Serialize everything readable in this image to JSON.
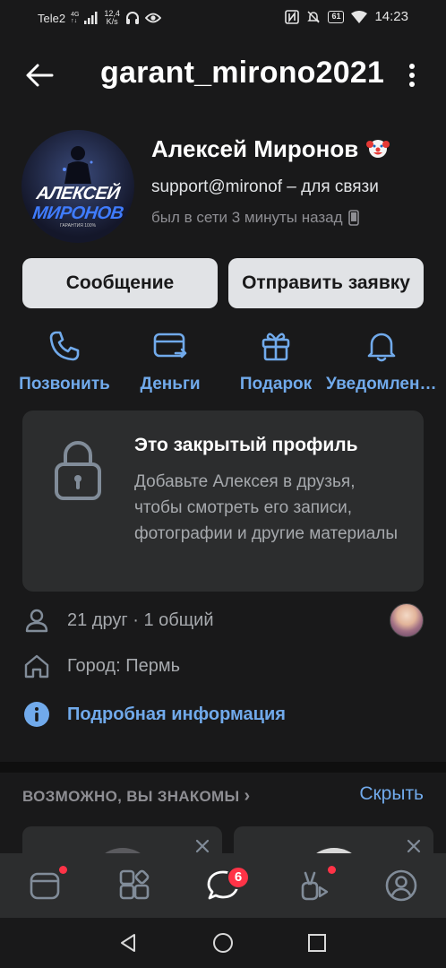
{
  "status_bar": {
    "carrier": "Tele2",
    "network_top": "4G",
    "network_bottom": "↑↓",
    "speed_value": "12,4",
    "speed_unit": "K/s",
    "battery": "61",
    "time": "14:23"
  },
  "header": {
    "title": "garant_mirono2021"
  },
  "profile": {
    "name": "Алексей Миронов",
    "name_emoji": "clown-face",
    "status": "support@mironof – для связи",
    "last_seen": "был в сети 3 минуты назад",
    "avatar_text_line1": "АЛЕКСЕЙ",
    "avatar_text_line2": "МИРОНОВ",
    "avatar_small_text": "ГАРАНТИЯ 100%"
  },
  "buttons": {
    "message": "Сообщение",
    "friend_request": "Отправить заявку"
  },
  "quick_actions": [
    {
      "label": "Позвонить",
      "icon": "phone-icon"
    },
    {
      "label": "Деньги",
      "icon": "money-transfer-icon"
    },
    {
      "label": "Подарок",
      "icon": "gift-icon"
    },
    {
      "label": "Уведомления",
      "icon": "bell-icon"
    }
  ],
  "closed_profile": {
    "title": "Это закрытый профиль",
    "text": "Добавьте Алексея в друзья, чтобы смотреть его записи, фотографии и другие материалы"
  },
  "info": {
    "friends": "21 друг · 1 общий",
    "city": "Город: Пермь",
    "details_link": "Подробная информация"
  },
  "suggestions": {
    "title": "ВОЗМОЖНО, ВЫ ЗНАКОМЫ",
    "chevron": "›",
    "hide": "Скрыть"
  },
  "tabbar": {
    "messages_badge": "6",
    "icons": [
      "news-icon",
      "services-icon",
      "messages-icon",
      "clips-icon",
      "profile-icon"
    ]
  },
  "colors": {
    "background": "#19191a",
    "card": "#2c2d2e",
    "accent": "#71aaeb",
    "badge": "#ff3347"
  }
}
